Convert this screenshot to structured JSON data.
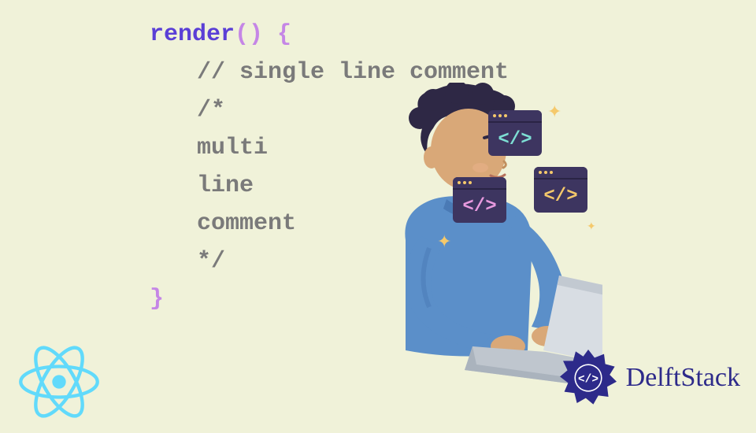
{
  "code": {
    "l1_kw": "render",
    "l1_fn": "()",
    "l1_brace": " {",
    "l2": "// single line comment",
    "l3": "/*",
    "l4": "multi",
    "l5": "line",
    "l6": "comment",
    "l7": "*/",
    "l8": "}"
  },
  "windows": {
    "w1": "</>",
    "w2": "</>",
    "w3": "</>"
  },
  "sparkles": {
    "s1": "✦",
    "s2": "✦",
    "s3": "✦"
  },
  "brand": {
    "name": "DelftStack"
  }
}
